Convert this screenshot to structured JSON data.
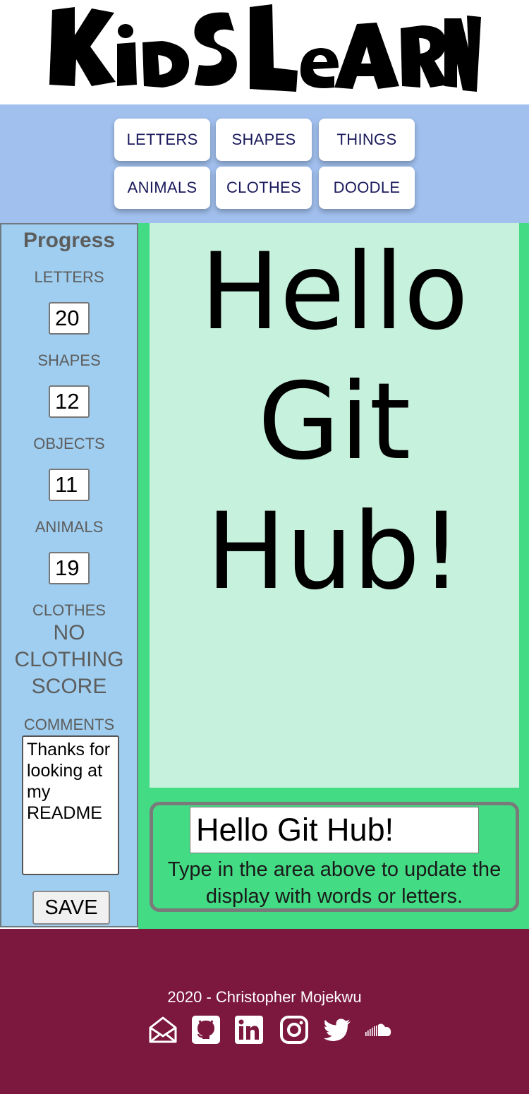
{
  "header": {
    "logo_text": "Kids Learn"
  },
  "nav": {
    "buttons": [
      "LETTERS",
      "SHAPES",
      "THINGS",
      "ANIMALS",
      "CLOTHES",
      "DOODLE"
    ]
  },
  "sidebar": {
    "title": "Progress",
    "letters_label": "LETTERS",
    "letters_score": "20",
    "shapes_label": "SHAPES",
    "shapes_score": "12",
    "objects_label": "OBJECTS",
    "objects_score": "11",
    "animals_label": "ANIMALS",
    "animals_score": "19",
    "clothes_label": "CLOTHES",
    "clothes_score": "NO CLOTHING SCORE",
    "comments_label": "COMMENTS",
    "comments_value": "Thanks for looking at my README",
    "save_label": "SAVE"
  },
  "main": {
    "display_text": "Hello Git Hub!",
    "input_value": "Hello Git Hub!",
    "help_text": "Type in the area above to update the display with words or letters."
  },
  "footer": {
    "credit": "2020 - Christopher Mojekwu",
    "icons": [
      "envelope-icon",
      "github-icon",
      "linkedin-icon",
      "instagram-icon",
      "twitter-icon",
      "soundcloud-icon"
    ]
  },
  "colors": {
    "nav_bg": "#a1c0ee",
    "sidebar_bg": "#9fcef0",
    "main_bg": "#44db85",
    "display_bg": "#c6f1dc",
    "footer_bg": "#7c183e"
  }
}
